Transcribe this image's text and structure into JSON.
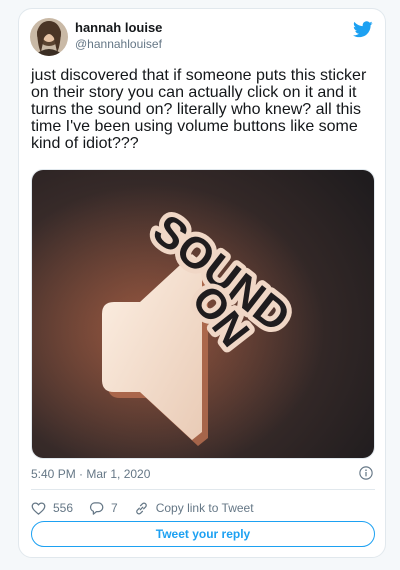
{
  "tweet": {
    "author_name": "hannah louise",
    "author_handle": "@hannahlouisef",
    "text": "just discovered that if someone puts this sticker on their story you can actually click on it and it turns the sound on? literally who knew? all this time I've been using volume buttons like some kind of idiot???",
    "image": {
      "sticker_text_line1": "SOUND",
      "sticker_text_line2": "ON",
      "icon": "speaker-icon"
    },
    "timestamp": "5:40 PM · Mar 1, 2020"
  },
  "actions": {
    "likes": "556",
    "replies": "7",
    "copy_link_label": "Copy link to Tweet",
    "reply_button_label": "Tweet your reply"
  },
  "icons": {
    "brand": "twitter-bird-icon",
    "info": "info-icon",
    "like": "heart-icon",
    "reply": "reply-bubble-icon",
    "link": "link-icon"
  },
  "colors": {
    "brand_blue": "#1da1f2",
    "text": "#14171a",
    "secondary_text": "#657786",
    "border": "#e1e8ed"
  }
}
